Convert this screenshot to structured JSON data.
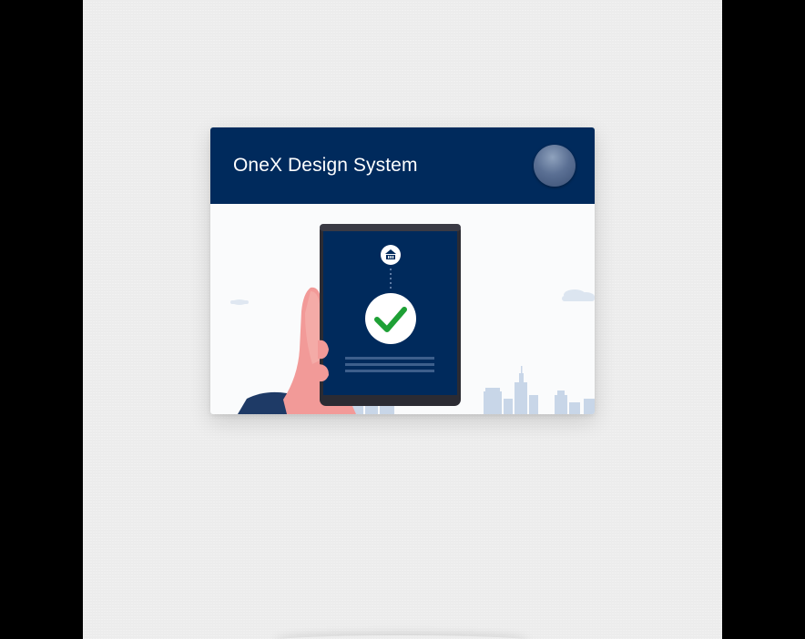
{
  "header": {
    "title": "OneX Design System",
    "avatar_icon": "user-avatar"
  },
  "illustration": {
    "icons": [
      "bank-icon",
      "checkmark-icon"
    ],
    "colors": {
      "header_bg": "#002a5c",
      "phone_screen": "#002a5c",
      "check": "#1ea035",
      "skyline": "#c5d4e6",
      "hand": "#f29a98"
    }
  }
}
